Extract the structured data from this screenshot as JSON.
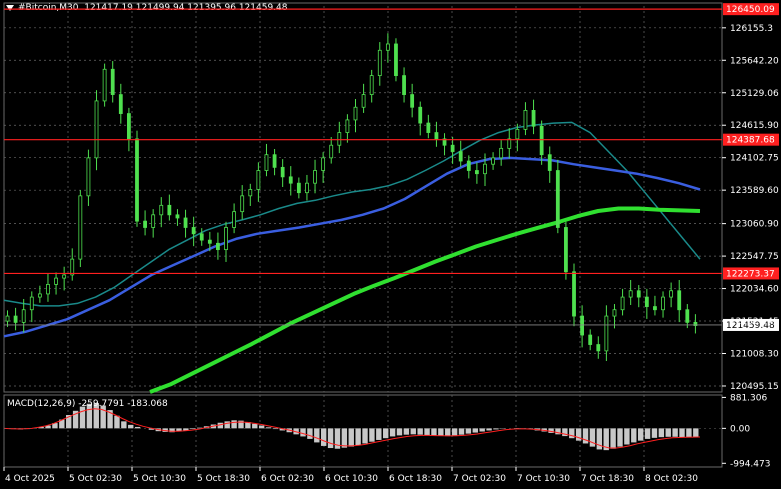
{
  "header": {
    "symbol": "#Bitcoin",
    "timeframe": "M30",
    "ohlc": "121417.19 121499.94 121395.96 121459.48"
  },
  "colors": {
    "background": "#000000",
    "candle": "#4fe04f",
    "level_line": "#ff2020",
    "ma_fast": "#1a8a8a",
    "ma_mid": "#3a5ee0",
    "ma_slow": "#30e030",
    "macd_hist": "#c8c8c8",
    "macd_signal": "#ff2020",
    "grid": "#6a6a6a",
    "axis_text": "#ffffff"
  },
  "chart_data": [
    {
      "type": "candlestick",
      "x_ticks": [
        "4 Oct 2025",
        "5 Oct 02:30",
        "5 Oct 10:30",
        "5 Oct 18:30",
        "6 Oct 02:30",
        "6 Oct 10:30",
        "6 Oct 18:30",
        "7 Oct 02:30",
        "7 Oct 10:30",
        "7 Oct 18:30",
        "8 Oct 02:30"
      ],
      "y_ticks": [
        "126155.3",
        "125642.20",
        "125129.06",
        "124615.90",
        "124102.75",
        "123589.60",
        "123060.90",
        "122547.75",
        "122034.60",
        "121521.45",
        "121008.30",
        "120495.15"
      ],
      "ylim": [
        120400,
        126500
      ],
      "levels": [
        {
          "value": 126450.09,
          "label": "126450.09"
        },
        {
          "value": 124387.68,
          "label": "124387.68"
        },
        {
          "value": 122273.37,
          "label": "122273.37"
        }
      ],
      "current_price": {
        "value": 121459.48,
        "label": "121459.48"
      },
      "close_series": [
        121600,
        121500,
        121700,
        121900,
        121950,
        122100,
        122200,
        122250,
        122500,
        123500,
        124100,
        125000,
        125500,
        125100,
        124800,
        124400,
        123100,
        123000,
        123200,
        123350,
        123200,
        123150,
        123000,
        122900,
        122800,
        122750,
        122650,
        123000,
        123250,
        123500,
        123600,
        123900,
        124150,
        123950,
        123800,
        123700,
        123550,
        123700,
        123900,
        124100,
        124300,
        124500,
        124700,
        124900,
        125100,
        125400,
        125800,
        125900,
        125400,
        125100,
        124900,
        124650,
        124500,
        124400,
        124300,
        124200,
        124050,
        123900,
        123850,
        124000,
        124100,
        124250,
        124400,
        124550,
        124850,
        124600,
        124150,
        123900,
        123000,
        122300,
        121600,
        121300,
        121150,
        121050,
        121600,
        121700,
        121900,
        122000,
        121900,
        121750,
        121700,
        121900,
        122000,
        121700,
        121500,
        121450
      ],
      "moving_averages": [
        {
          "key": "fast",
          "values": [
            121850,
            121800,
            121760,
            121760,
            121800,
            121900,
            122050,
            122250,
            122450,
            122650,
            122800,
            122950,
            123050,
            123120,
            123200,
            123300,
            123380,
            123430,
            123500,
            123560,
            123600,
            123660,
            123760,
            123900,
            124050,
            124220,
            124380,
            124500,
            124580,
            124620,
            124650,
            124660,
            124500,
            124200,
            123900,
            123550,
            123200,
            122850,
            122500
          ]
        },
        {
          "key": "mid",
          "values": [
            121280,
            121350,
            121450,
            121550,
            121700,
            121850,
            122050,
            122250,
            122400,
            122550,
            122700,
            122820,
            122900,
            122950,
            123000,
            123060,
            123120,
            123200,
            123300,
            123450,
            123650,
            123850,
            124000,
            124080,
            124100,
            124080,
            124060,
            124000,
            123950,
            123900,
            123850,
            123780,
            123700,
            123600
          ]
        },
        {
          "key": "slow",
          "values": [
            120400,
            120520,
            120680,
            120840,
            121000,
            121160,
            121330,
            121500,
            121650,
            121800,
            121950,
            122080,
            122200,
            122330,
            122460,
            122580,
            122700,
            122800,
            122900,
            122990,
            123080,
            123180,
            123260,
            123300,
            123300,
            123280,
            123270,
            123260
          ]
        }
      ]
    },
    {
      "type": "bar",
      "title": "MACD(12,26,9)",
      "main_value": "-259.7791",
      "signal_value": "-183.068",
      "y_ticks": [
        "881.306",
        "0.00",
        "-994.473"
      ],
      "ylim": [
        -1100,
        950
      ],
      "histogram": [
        0,
        -20,
        -30,
        -20,
        10,
        40,
        80,
        150,
        250,
        380,
        500,
        620,
        700,
        720,
        650,
        520,
        360,
        200,
        100,
        40,
        0,
        -40,
        -80,
        -100,
        -110,
        -90,
        -60,
        -20,
        20,
        60,
        110,
        160,
        200,
        230,
        220,
        180,
        130,
        80,
        30,
        -20,
        -60,
        -110,
        -170,
        -230,
        -300,
        -400,
        -500,
        -560,
        -580,
        -550,
        -520,
        -480,
        -430,
        -380,
        -330,
        -280,
        -230,
        -200,
        -180,
        -170,
        -180,
        -190,
        -200,
        -210,
        -220,
        -200,
        -180,
        -150,
        -120,
        -90,
        -60,
        -30,
        -10,
        0,
        10,
        -10,
        -30,
        -60,
        -90,
        -130,
        -170,
        -220,
        -280,
        -350,
        -430,
        -520,
        -600,
        -620,
        -580,
        -520,
        -460,
        -400,
        -350,
        -300,
        -270,
        -250,
        -240,
        -240,
        -250,
        -260,
        -260
      ],
      "signal": [
        0,
        -10,
        -15,
        -10,
        0,
        30,
        70,
        130,
        210,
        300,
        390,
        470,
        530,
        560,
        540,
        470,
        380,
        280,
        190,
        120,
        60,
        10,
        -30,
        -60,
        -80,
        -80,
        -70,
        -50,
        -20,
        20,
        60,
        100,
        140,
        170,
        180,
        170,
        140,
        110,
        70,
        30,
        -10,
        -50,
        -100,
        -150,
        -210,
        -280,
        -360,
        -430,
        -480,
        -500,
        -500,
        -480,
        -450,
        -410,
        -370,
        -330,
        -290,
        -260,
        -230,
        -210,
        -200,
        -200,
        -205,
        -210,
        -215,
        -210,
        -200,
        -180,
        -160,
        -130,
        -100,
        -70,
        -40,
        -20,
        -10,
        -15,
        -25,
        -45,
        -70,
        -100,
        -140,
        -180,
        -230,
        -290,
        -360,
        -440,
        -510,
        -560,
        -560,
        -530,
        -490,
        -440,
        -400,
        -360,
        -320,
        -290,
        -270,
        -260,
        -255,
        -250,
        -245
      ]
    }
  ]
}
